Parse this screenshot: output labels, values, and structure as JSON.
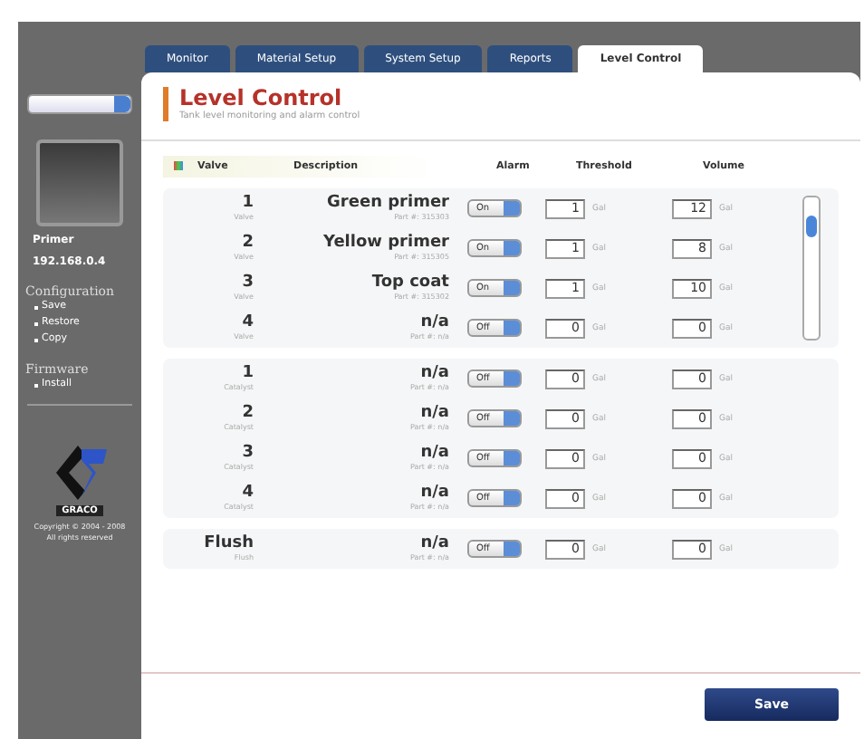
{
  "sidebar": {
    "device": {
      "name": "Primer",
      "address": "192.168.0.4"
    },
    "sections": [
      {
        "title": "Configuration",
        "items": [
          "Save",
          "Restore",
          "Copy"
        ]
      },
      {
        "title": "Firmware",
        "items": [
          "Install"
        ]
      }
    ],
    "logo_text": "GRACO",
    "copyright": [
      "Copyright © 2004 - 2008",
      "All rights reserved"
    ]
  },
  "tabs": [
    {
      "label": "Monitor",
      "selected": false
    },
    {
      "label": "Material Setup",
      "selected": false
    },
    {
      "label": "System Setup",
      "selected": false
    },
    {
      "label": "Reports",
      "selected": false
    },
    {
      "label": "Level Control",
      "selected": true
    }
  ],
  "page": {
    "title": "Level Control",
    "subtitle": "Tank level monitoring and alarm control"
  },
  "columns": [
    "Valve",
    "Description",
    "Alarm",
    "Threshold",
    "Volume"
  ],
  "groups": [
    {
      "scrollbar": true,
      "rows": [
        {
          "number": "1",
          "type": "Valve",
          "description": "Green primer",
          "part": "Part #: 315303",
          "alarm": "On",
          "threshold": "1",
          "threshold_unit": "Gal",
          "volume": "12",
          "volume_unit": "Gal"
        },
        {
          "number": "2",
          "type": "Valve",
          "description": "Yellow primer",
          "part": "Part #: 315305",
          "alarm": "On",
          "threshold": "1",
          "threshold_unit": "Gal",
          "volume": "8",
          "volume_unit": "Gal"
        },
        {
          "number": "3",
          "type": "Valve",
          "description": "Top coat",
          "part": "Part #: 315302",
          "alarm": "On",
          "threshold": "1",
          "threshold_unit": "Gal",
          "volume": "10",
          "volume_unit": "Gal"
        },
        {
          "number": "4",
          "type": "Valve",
          "description": "n/a",
          "part": "Part #: n/a",
          "alarm": "Off",
          "threshold": "0",
          "threshold_unit": "Gal",
          "volume": "0",
          "volume_unit": "Gal"
        }
      ]
    },
    {
      "scrollbar": false,
      "rows": [
        {
          "number": "1",
          "type": "Catalyst",
          "description": "n/a",
          "part": "Part #: n/a",
          "alarm": "Off",
          "threshold": "0",
          "threshold_unit": "Gal",
          "volume": "0",
          "volume_unit": "Gal"
        },
        {
          "number": "2",
          "type": "Catalyst",
          "description": "n/a",
          "part": "Part #: n/a",
          "alarm": "Off",
          "threshold": "0",
          "threshold_unit": "Gal",
          "volume": "0",
          "volume_unit": "Gal"
        },
        {
          "number": "3",
          "type": "Catalyst",
          "description": "n/a",
          "part": "Part #: n/a",
          "alarm": "Off",
          "threshold": "0",
          "threshold_unit": "Gal",
          "volume": "0",
          "volume_unit": "Gal"
        },
        {
          "number": "4",
          "type": "Catalyst",
          "description": "n/a",
          "part": "Part #: n/a",
          "alarm": "Off",
          "threshold": "0",
          "threshold_unit": "Gal",
          "volume": "0",
          "volume_unit": "Gal"
        }
      ]
    },
    {
      "scrollbar": false,
      "rows": [
        {
          "number": "Flush",
          "type": "Flush",
          "description": "n/a",
          "part": "Part #: n/a",
          "alarm": "Off",
          "threshold": "0",
          "threshold_unit": "Gal",
          "volume": "0",
          "volume_unit": "Gal"
        }
      ]
    }
  ],
  "save_button": "Save"
}
